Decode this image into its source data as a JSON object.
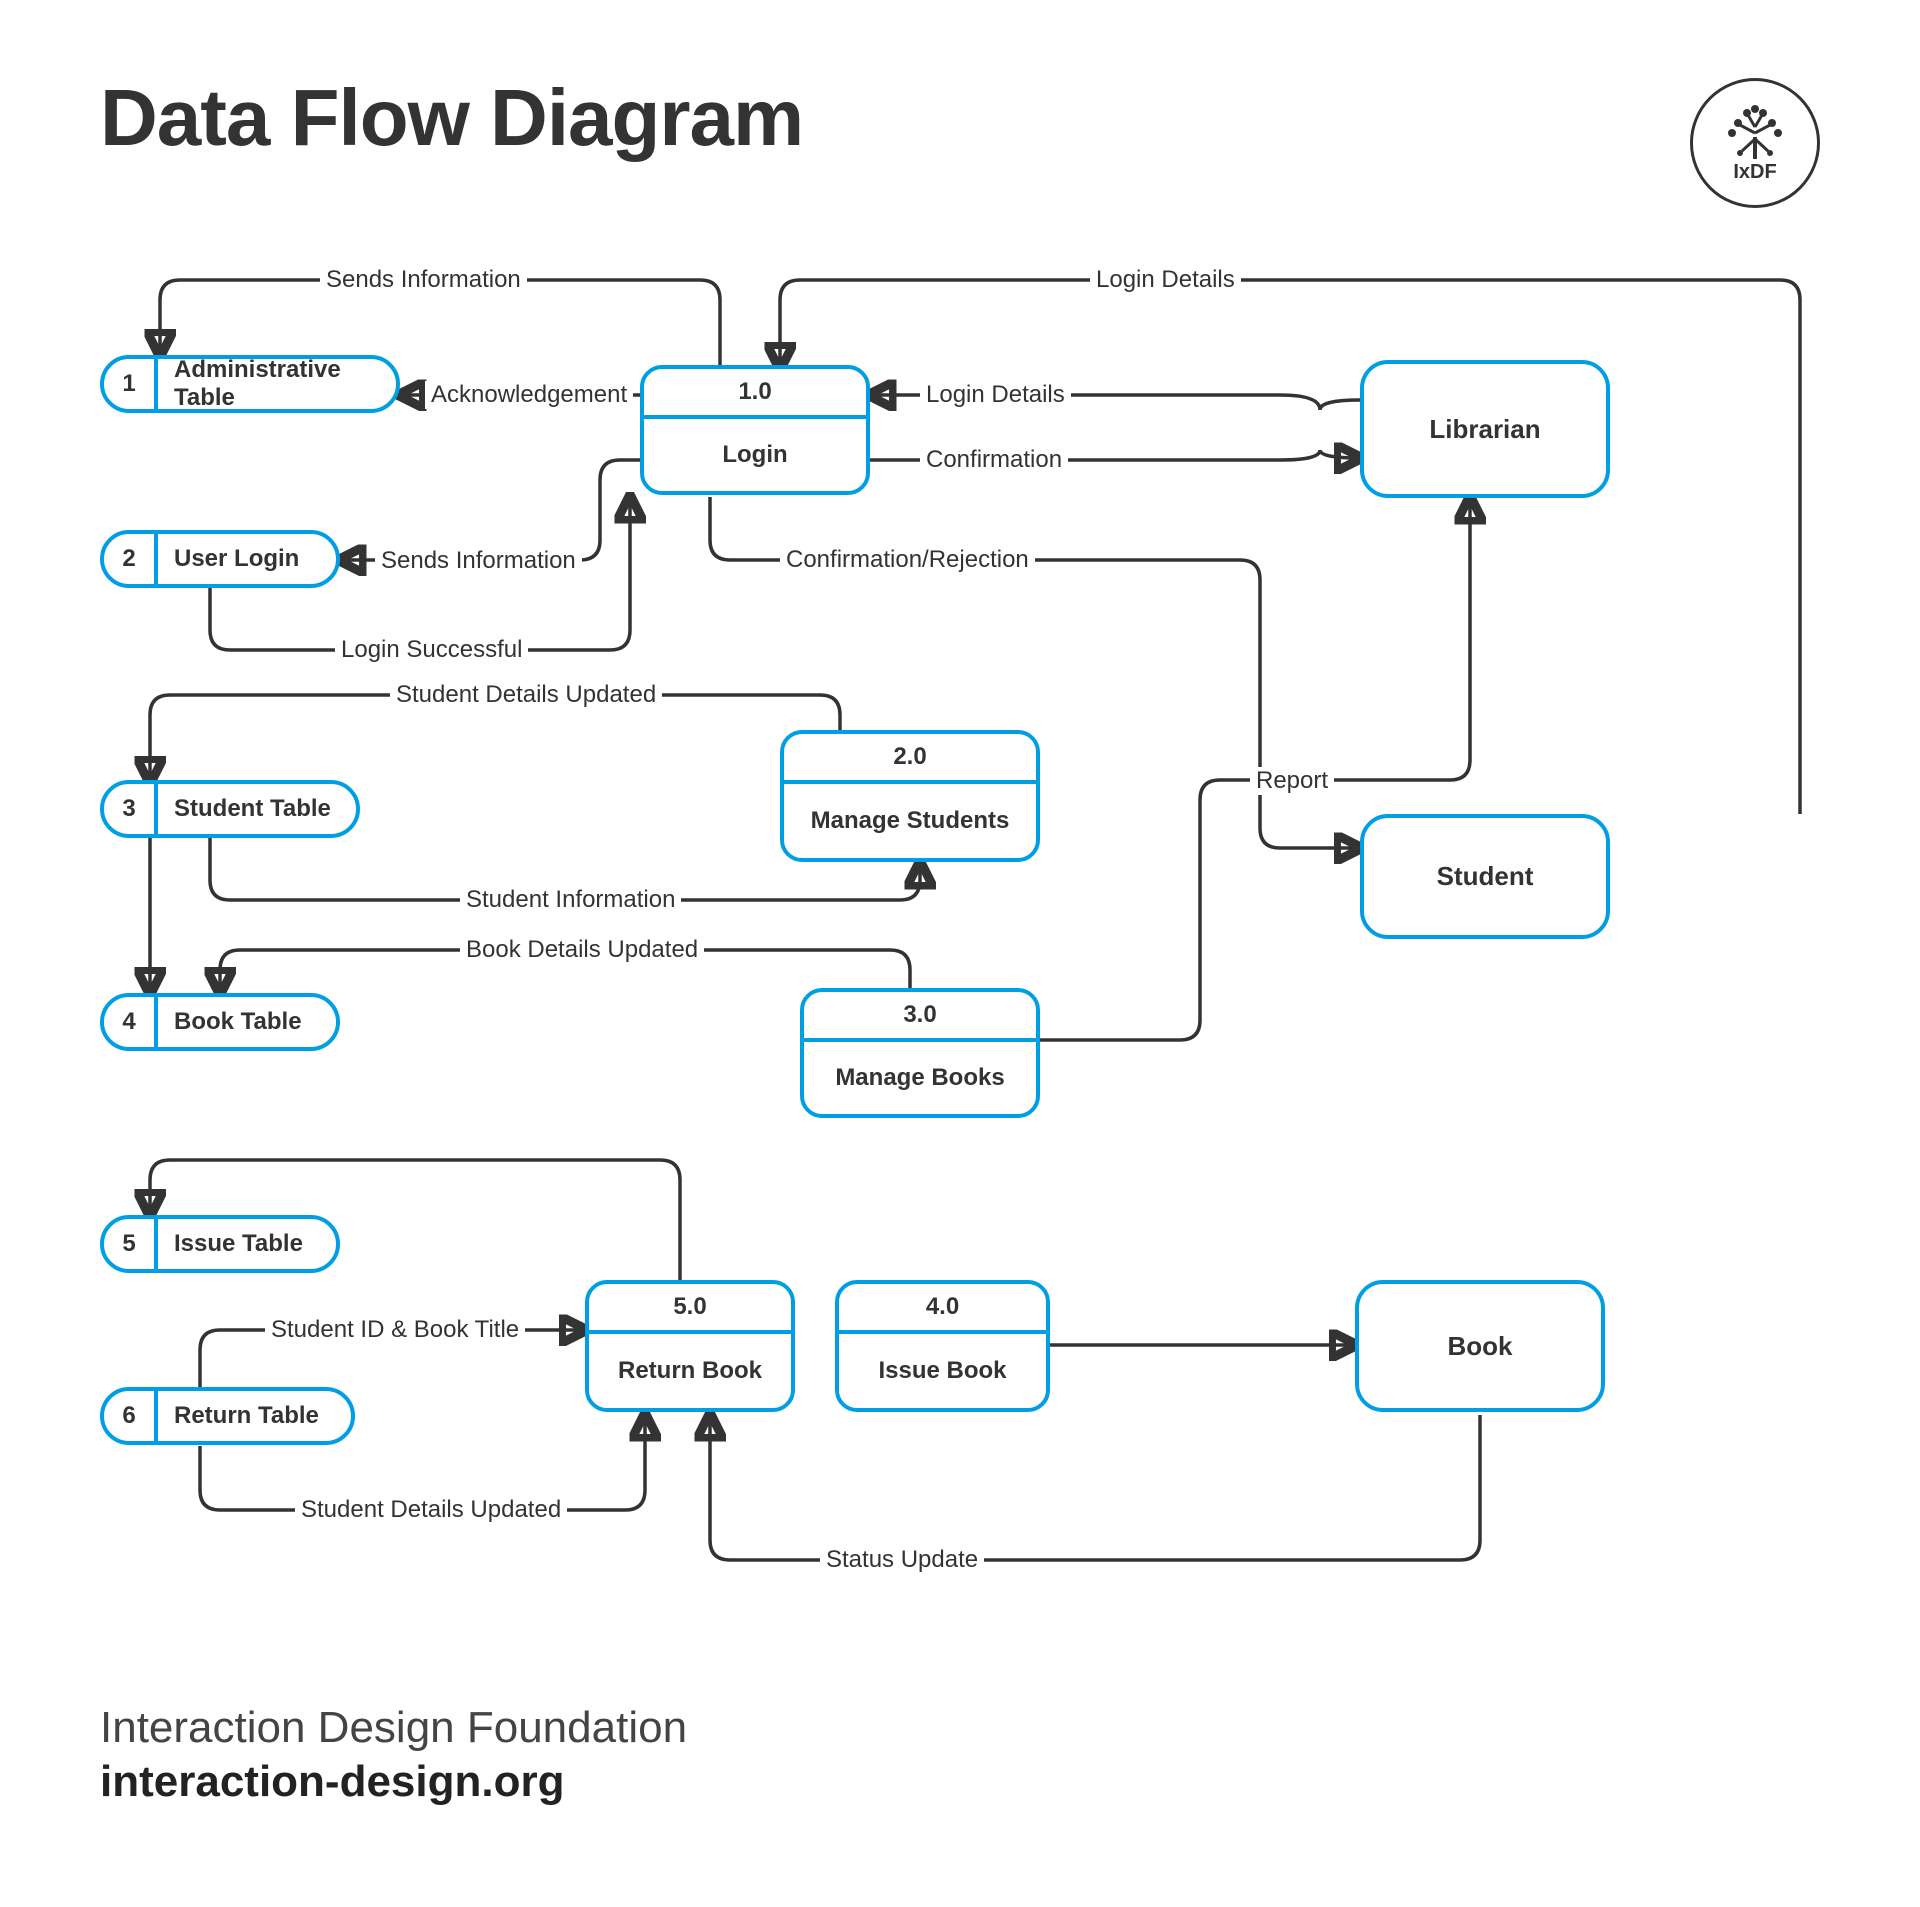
{
  "title": "Data Flow Diagram",
  "logo": {
    "abbr": "IxDF",
    "alt": "Interaction Design Foundation"
  },
  "footer": {
    "org": "Interaction Design Foundation",
    "url": "interaction-design.org"
  },
  "data_stores": {
    "ds1": {
      "num": "1",
      "label": "Administrative Table"
    },
    "ds2": {
      "num": "2",
      "label": "User Login"
    },
    "ds3": {
      "num": "3",
      "label": "Student Table"
    },
    "ds4": {
      "num": "4",
      "label": "Book Table"
    },
    "ds5": {
      "num": "5",
      "label": "Issue Table"
    },
    "ds6": {
      "num": "6",
      "label": "Return Table"
    }
  },
  "processes": {
    "p1": {
      "id": "1.0",
      "name": "Login"
    },
    "p2": {
      "id": "2.0",
      "name": "Manage Students"
    },
    "p3": {
      "id": "3.0",
      "name": "Manage Books"
    },
    "p4": {
      "id": "4.0",
      "name": "Issue Book"
    },
    "p5": {
      "id": "5.0",
      "name": "Return Book"
    }
  },
  "entities": {
    "librarian": {
      "name": "Librarian"
    },
    "student": {
      "name": "Student"
    },
    "book": {
      "name": "Book"
    }
  },
  "flows": {
    "f_sends_info_admin": "Sends Information",
    "f_ack": "Acknowledgement",
    "f_login_details_top": "Login Details",
    "f_login_details_lib": "Login Details",
    "f_confirmation": "Confirmation",
    "f_sends_info_user": "Sends Information",
    "f_login_successful": "Login Successful",
    "f_conf_rej": "Confirmation/Rejection",
    "f_student_details_upd": "Student Details Updated",
    "f_student_info": "Student Information",
    "f_book_details_upd": "Book Details Updated",
    "f_report": "Report",
    "f_id_title": "Student ID & Book Title",
    "f_student_details_upd2": "Student Details Updated",
    "f_status_update": "Status Update"
  }
}
